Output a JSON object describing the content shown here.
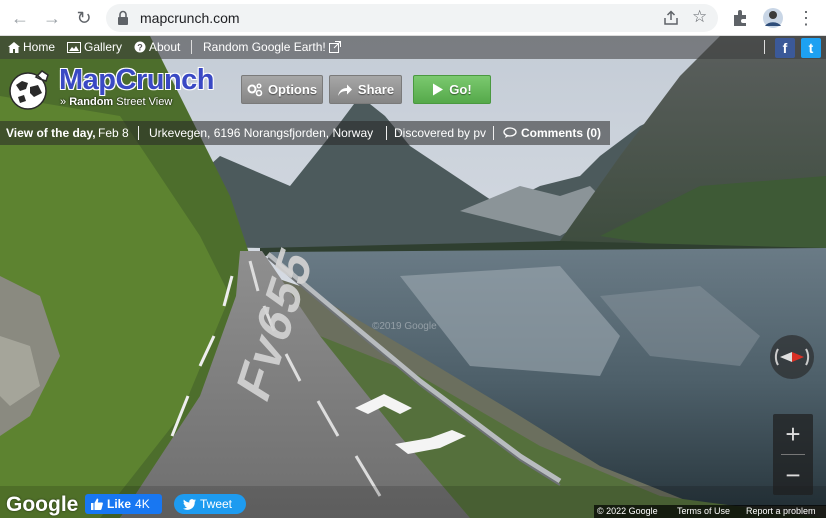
{
  "browser": {
    "url": "mapcrunch.com",
    "back_icon": "arrow-left-icon",
    "forward_icon": "arrow-right-icon",
    "reload_icon": "reload-icon"
  },
  "topnav": {
    "home": "Home",
    "gallery": "Gallery",
    "about": "About",
    "random_earth": "Random Google Earth!"
  },
  "social": {
    "facebook": "f",
    "twitter": "t"
  },
  "logo": {
    "title": "MapCrunch",
    "sub_prefix": "»",
    "sub_bold": "Random",
    "sub_rest": "Street View"
  },
  "buttons": {
    "options": "Options",
    "share": "Share",
    "go": "Go!"
  },
  "view_of_day": {
    "label": "View of the day,",
    "date": "Feb 8",
    "location": "Urkevegen, 6196 Norangsfjorden, Norway",
    "discovered": "Discovered by pv",
    "comments": "Comments (0)"
  },
  "scene": {
    "road_marking": "Fv655",
    "watermark": "©2019 Google"
  },
  "controls": {
    "zoom_in": "+",
    "zoom_out": "−"
  },
  "bottom": {
    "google": "Google",
    "like_label": "Like",
    "like_count": "4K",
    "tweet_label": "Tweet",
    "copyright": "© 2022 Google",
    "terms": "Terms of Use",
    "report": "Report a problem"
  },
  "colors": {
    "logo_blue": "#3a49c4",
    "go_green": "#5cb350",
    "facebook": "#3b5998",
    "twitter": "#1da1f2"
  }
}
